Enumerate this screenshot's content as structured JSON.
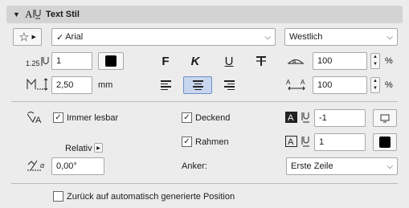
{
  "header": {
    "title": "Text Stil",
    "icon": "text-style-icon"
  },
  "font": {
    "name": "Arial",
    "check_mark": "✓",
    "encoding": "Westlich"
  },
  "size": {
    "value": "1",
    "unit": "%",
    "line_spacing": "100"
  },
  "width": {
    "value": "2,50",
    "unit": "mm",
    "spacing": "100"
  },
  "options": {
    "always_readable": "Immer lesbar",
    "opaque": "Deckend",
    "frame": "Rahmen",
    "relative": "Relativ",
    "angle": "0,00°",
    "anchor_label": "Anker:",
    "anchor_value": "Erste Zeile"
  },
  "pens": {
    "opaque_pen": "-1",
    "frame_pen": "1"
  },
  "reset": {
    "label": "Zurück auf automatisch generierte Position"
  },
  "colors": {
    "accent": "#6d8fc6",
    "header_bg": "#d3d3d3"
  }
}
